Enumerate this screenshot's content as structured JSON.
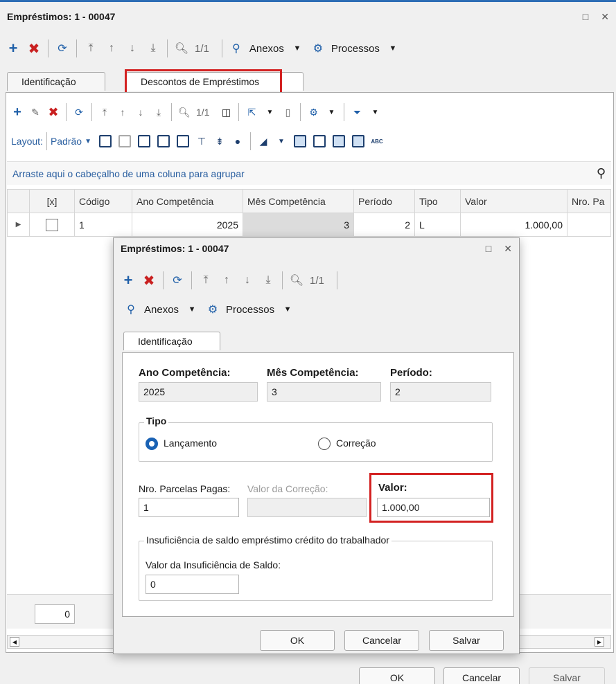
{
  "main": {
    "title": "Empréstimos: 1 - 00047",
    "restore_glyph": "□",
    "close_glyph": "✕",
    "toolbar": {
      "record_counter": "1/1",
      "anexos_label": "Anexos",
      "processos_label": "Processos"
    },
    "tabs": [
      {
        "label": "Identificação"
      },
      {
        "label": "Descontos de Empréstimos"
      }
    ],
    "grid_toolbar": {
      "record_counter": "1/1",
      "layout_label": "Layout:",
      "layout_value": "Padrão"
    },
    "group_hint": "Arraste aqui o cabeçalho de uma coluna para agrupar",
    "columns": [
      "[x]",
      "Código",
      "Ano Competência",
      "Mês Competência",
      "Período",
      "Tipo",
      "Valor",
      "Nro. Pa"
    ],
    "row": {
      "codigo": "1",
      "ano": "2025",
      "mes": "3",
      "periodo": "2",
      "tipo": "L",
      "valor": "1.000,00"
    },
    "footer_count": "0",
    "buttons": {
      "ok": "OK",
      "cancel": "Cancelar",
      "save": "Salvar"
    }
  },
  "dialog": {
    "title": "Empréstimos: 1 - 00047",
    "toolbar": {
      "record_counter": "1/1",
      "anexos_label": "Anexos",
      "processos_label": "Processos"
    },
    "tab_label": "Identificação",
    "ano_label": "Ano Competência:",
    "ano_value": "2025",
    "mes_label": "Mês Competência:",
    "mes_value": "3",
    "periodo_label": "Período:",
    "periodo_value": "2",
    "tipo_legend": "Tipo",
    "tipo_options": [
      "Lançamento",
      "Correção"
    ],
    "tipo_selected": "Lançamento",
    "parcelas_label": "Nro. Parcelas Pagas:",
    "parcelas_value": "1",
    "correcao_label": "Valor da Correção:",
    "valor_label": "Valor:",
    "valor_value": "1.000,00",
    "insuf_legend": "Insuficiência de saldo empréstimo crédito do trabalhador",
    "insuf_label": "Valor da Insuficiência de Saldo:",
    "insuf_value": "0",
    "buttons": {
      "ok": "OK",
      "cancel": "Cancelar",
      "save": "Salvar"
    }
  },
  "colors": {
    "accent": "#1f5fa8",
    "highlight_frame": "#d32222",
    "title_border": "#2d6db5"
  }
}
